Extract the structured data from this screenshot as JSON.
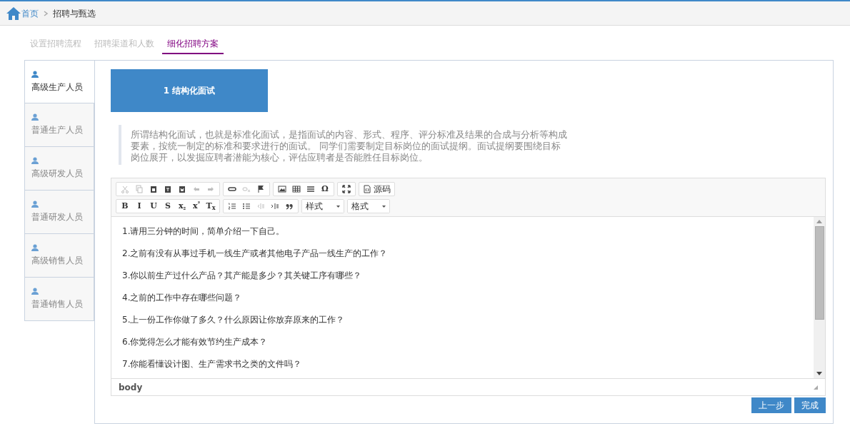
{
  "breadcrumb": {
    "home": "首页",
    "current": "招聘与甄选"
  },
  "steps": [
    {
      "label": "设置招聘流程",
      "selected": false
    },
    {
      "label": "招聘渠道和人数",
      "selected": false
    },
    {
      "label": "细化招聘方案",
      "selected": true
    }
  ],
  "sidebar": {
    "items": [
      {
        "label": "高级生产人员",
        "selected": true
      },
      {
        "label": "普通生产人员",
        "selected": false
      },
      {
        "label": "高级研发人员",
        "selected": false
      },
      {
        "label": "普通研发人员",
        "selected": false
      },
      {
        "label": "高级销售人员",
        "selected": false
      },
      {
        "label": "普通销售人员",
        "selected": false
      }
    ]
  },
  "section_title": "1 结构化面试",
  "description": "所谓结构化面试，也就是标准化面试，是指面试的内容、形式、程序、评分标准及结果的合成与分析等构成要素，按统一制定的标准和要求进行的面试。 同学们需要制定目标岗位的面试提纲。面试提纲要围绕目标岗位展开，以发掘应聘者潜能为核心，评估应聘者是否能胜任目标岗位。",
  "toolbar": {
    "rows": [
      [
        [
          {
            "kind": "cut",
            "disabled": true
          },
          {
            "kind": "copy",
            "disabled": true
          },
          {
            "kind": "paste",
            "disabled": false
          },
          {
            "kind": "paste-text",
            "disabled": false
          },
          {
            "kind": "paste-word",
            "disabled": false
          },
          {
            "kind": "undo",
            "disabled": true
          },
          {
            "kind": "redo",
            "disabled": true
          }
        ],
        [
          {
            "kind": "link",
            "disabled": false
          },
          {
            "kind": "unlink",
            "disabled": true
          },
          {
            "kind": "anchor",
            "disabled": false
          }
        ],
        [
          {
            "kind": "image",
            "disabled": false
          },
          {
            "kind": "table",
            "disabled": false
          },
          {
            "kind": "hr",
            "disabled": false
          },
          {
            "kind": "char",
            "label": "Ω",
            "disabled": false
          }
        ],
        [
          {
            "kind": "maximize",
            "disabled": false
          }
        ],
        [
          {
            "kind": "source",
            "label": "源码",
            "disabled": false
          }
        ]
      ],
      [
        [
          {
            "kind": "char",
            "label": "B",
            "disabled": false
          },
          {
            "kind": "char",
            "label": "I",
            "disabled": false
          },
          {
            "kind": "char",
            "label": "U",
            "disabled": false
          },
          {
            "kind": "char",
            "label": "S",
            "disabled": false
          },
          {
            "kind": "char",
            "label": "x$_{₂}$",
            "disabled": false
          },
          {
            "kind": "char",
            "label": "x$^{²}$",
            "disabled": false
          },
          {
            "kind": "char",
            "label": "T$_{x}$",
            "disabled": false
          }
        ],
        [
          {
            "kind": "numbered-list",
            "disabled": false
          },
          {
            "kind": "bullet-list",
            "disabled": false
          },
          {
            "kind": "outdent",
            "disabled": true
          },
          {
            "kind": "indent",
            "disabled": false
          },
          {
            "kind": "quote",
            "disabled": false
          }
        ],
        [
          {
            "kind": "dropdown",
            "label": "样式",
            "disabled": false
          }
        ],
        [
          {
            "kind": "dropdown",
            "label": "格式",
            "disabled": false
          }
        ]
      ]
    ]
  },
  "editor_lines": [
    "1.请用三分钟的时间，简单介绍一下自己。",
    "2.之前有没有从事过手机一线生产或者其他电子产品一线生产的工作？",
    "3.你以前生产过什么产品？其产能是多少？其关键工序有哪些？",
    "4.之前的工作中存在哪些问题？",
    "5.上一份工作你做了多久？什么原因让你放弃原来的工作？",
    "6.你觉得怎么才能有效节约生产成本？",
    "7.你能看懂设计图、生产需求书之类的文件吗？"
  ],
  "editor_status": "body",
  "buttons": [
    "上一步",
    "完成"
  ]
}
